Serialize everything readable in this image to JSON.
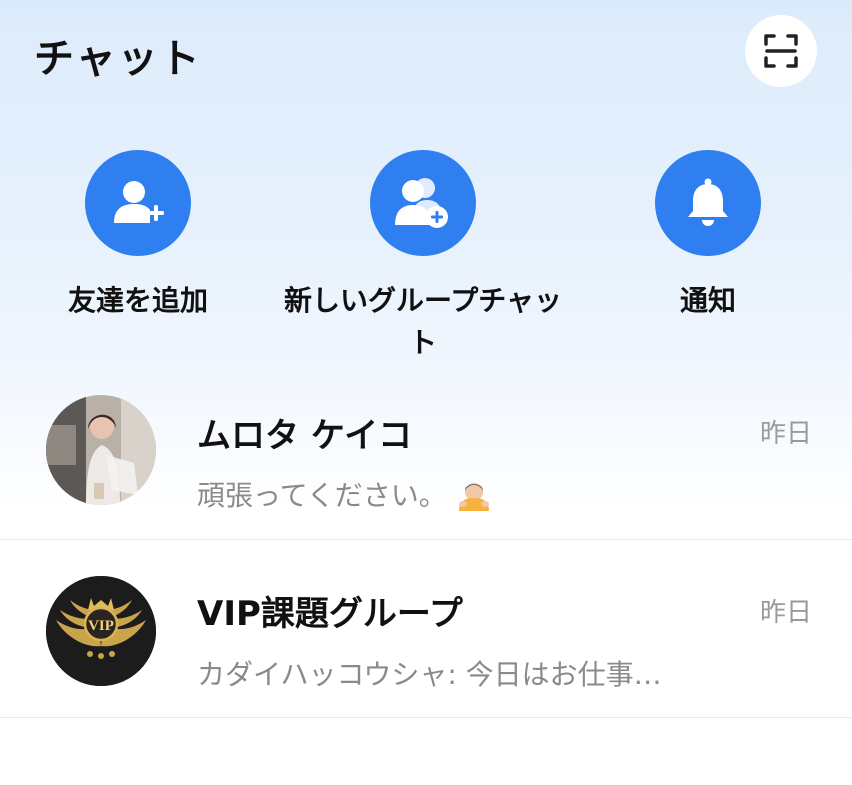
{
  "header": {
    "title": "チャット",
    "scan_icon": "scan-icon"
  },
  "actions": [
    {
      "label": "友達を追加",
      "icon": "add-friend-icon"
    },
    {
      "label": "新しいグループチャット",
      "icon": "new-group-icon"
    },
    {
      "label": "通知",
      "icon": "bell-icon"
    }
  ],
  "chats": [
    {
      "name": "ムロタ ケイコ",
      "message": "頑張ってください。",
      "time": "昨日",
      "emoji": "bowing-person-emoji"
    },
    {
      "name": "VIP課題グループ",
      "message": "カダイハッコウシャ: 今日はお仕事…",
      "time": "昨日",
      "avatar_text": "VIP"
    }
  ],
  "colors": {
    "accent": "#2f7ff0",
    "background_top": "#dcebfb",
    "muted_text": "#8a8a8a"
  }
}
